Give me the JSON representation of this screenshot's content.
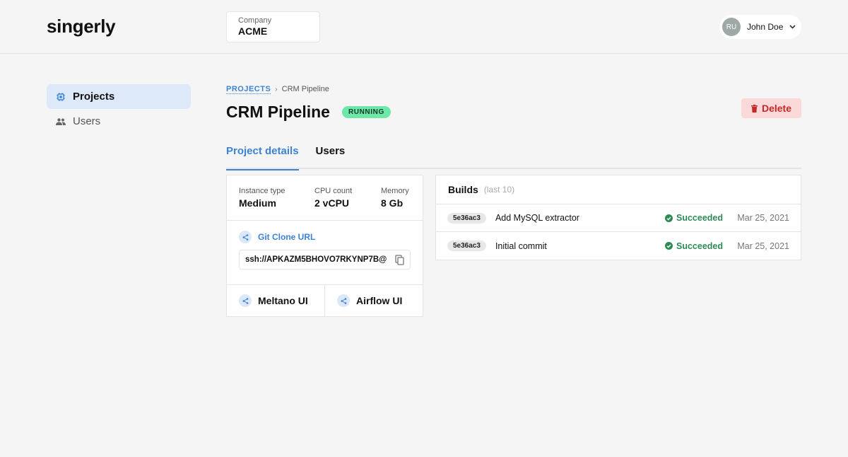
{
  "app": {
    "logo": "singerly"
  },
  "company": {
    "label": "Company",
    "value": "ACME"
  },
  "user": {
    "initials": "RU",
    "name": "John Doe"
  },
  "sidebar": {
    "items": [
      {
        "label": "Projects",
        "icon": "chip-icon",
        "active": true
      },
      {
        "label": "Users",
        "icon": "people-icon",
        "active": false
      }
    ]
  },
  "breadcrumb": {
    "root": "PROJECTS",
    "current": "CRM Pipeline"
  },
  "project": {
    "title": "CRM Pipeline",
    "status": "RUNNING",
    "delete_label": "Delete"
  },
  "tabs": [
    {
      "label": "Project details",
      "active": true
    },
    {
      "label": "Users",
      "active": false
    }
  ],
  "specs": [
    {
      "label": "Instance type",
      "value": "Medium"
    },
    {
      "label": "CPU count",
      "value": "2 vCPU"
    },
    {
      "label": "Memory",
      "value": "8 Gb"
    }
  ],
  "git": {
    "label": "Git Clone URL",
    "url": "ssh://APKAZM5BHOVO7RKYNP7B@"
  },
  "links": [
    {
      "label": "Meltano UI"
    },
    {
      "label": "Airflow UI"
    }
  ],
  "builds": {
    "title": "Builds",
    "subtitle": "(last 10)",
    "rows": [
      {
        "hash": "5e36ac3",
        "message": "Add MySQL extractor",
        "status": "Succeeded",
        "date": "Mar 25, 2021"
      },
      {
        "hash": "5e36ac3",
        "message": "Initial commit",
        "status": "Succeeded",
        "date": "Mar 25, 2021"
      }
    ]
  },
  "colors": {
    "accent": "#3b82d6",
    "running_badge": "#6ee7a8",
    "success": "#2e8a55",
    "danger": "#c62828",
    "danger_bg": "#fcd9d9"
  }
}
